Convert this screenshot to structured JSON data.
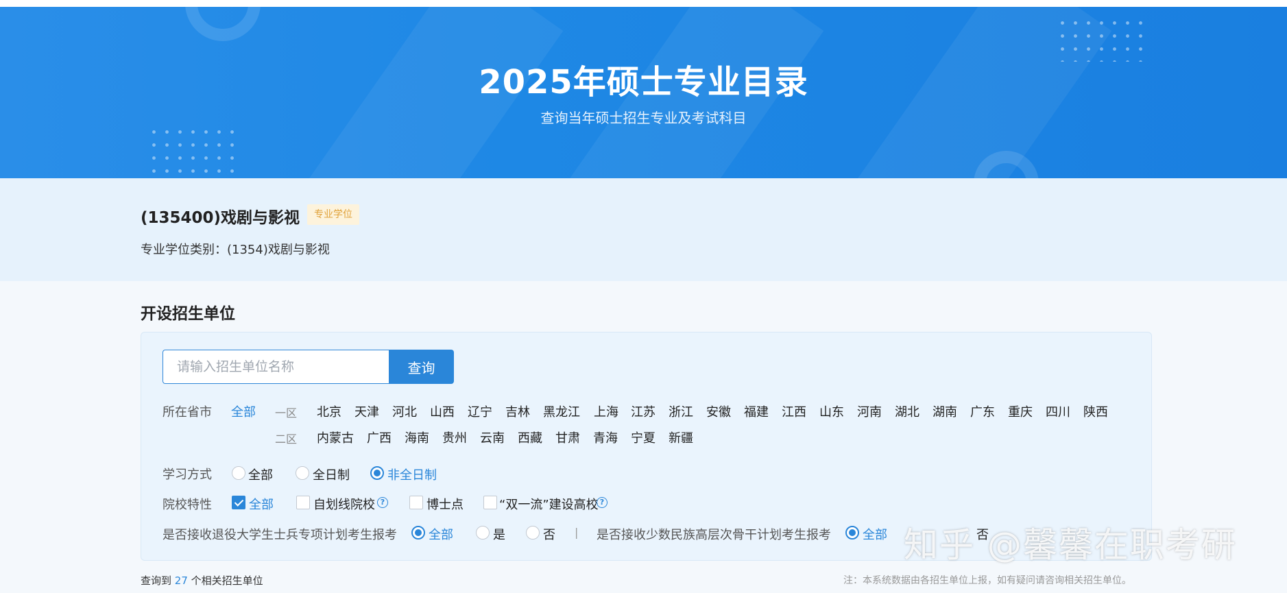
{
  "hero": {
    "title": "2025年硕士专业目录",
    "subtitle": "查询当年硕士招生专业及考试科目"
  },
  "major": {
    "title": "(135400)戏剧与影视",
    "badge": "专业学位",
    "category": "专业学位类别：(1354)戏剧与影视"
  },
  "section": {
    "title": "开设招生单位"
  },
  "search": {
    "placeholder": "请输入招生单位名称",
    "button_label": "查询"
  },
  "province_filter": {
    "label": "所在省市",
    "all_label": "全部",
    "zone1_label": "一区",
    "zone1": [
      "北京",
      "天津",
      "河北",
      "山西",
      "辽宁",
      "吉林",
      "黑龙江",
      "上海",
      "江苏",
      "浙江",
      "安徽",
      "福建",
      "江西",
      "山东",
      "河南",
      "湖北",
      "湖南",
      "广东",
      "重庆",
      "四川",
      "陕西"
    ],
    "zone2_label": "二区",
    "zone2": [
      "内蒙古",
      "广西",
      "海南",
      "贵州",
      "云南",
      "西藏",
      "甘肃",
      "青海",
      "宁夏",
      "新疆"
    ]
  },
  "study_mode": {
    "label": "学习方式",
    "options": [
      "全部",
      "全日制",
      "非全日制"
    ],
    "selected": "非全日制"
  },
  "school_features": {
    "label": "院校特性",
    "options": [
      "全部",
      "自划线院校",
      "博士点",
      "“双一流”建设高校"
    ],
    "checked": [
      "全部"
    ]
  },
  "veteran_plan": {
    "label": "是否接收退役大学生士兵专项计划考生报考",
    "options": [
      "全部",
      "是",
      "否"
    ],
    "selected": "全部"
  },
  "divider": "|",
  "minority_plan": {
    "label": "是否接收少数民族高层次骨干计划考生报考",
    "options": [
      "全部",
      "否"
    ],
    "selected": "全部"
  },
  "results": {
    "prefix": "查询到 ",
    "count": "27",
    "suffix": " 个相关招生单位"
  },
  "note": "注：本系统数据由各招生单位上报，如有疑问请咨询相关招生单位。",
  "watermark": "知乎 @馨馨在职考研",
  "icons": {
    "help": "question-circle-icon",
    "check": "checkmark-icon"
  },
  "colors": {
    "primary": "#2a86d9",
    "hero": "#1e88e5",
    "badge_text": "#e0a23a",
    "badge_bg": "#fdf3dc"
  }
}
